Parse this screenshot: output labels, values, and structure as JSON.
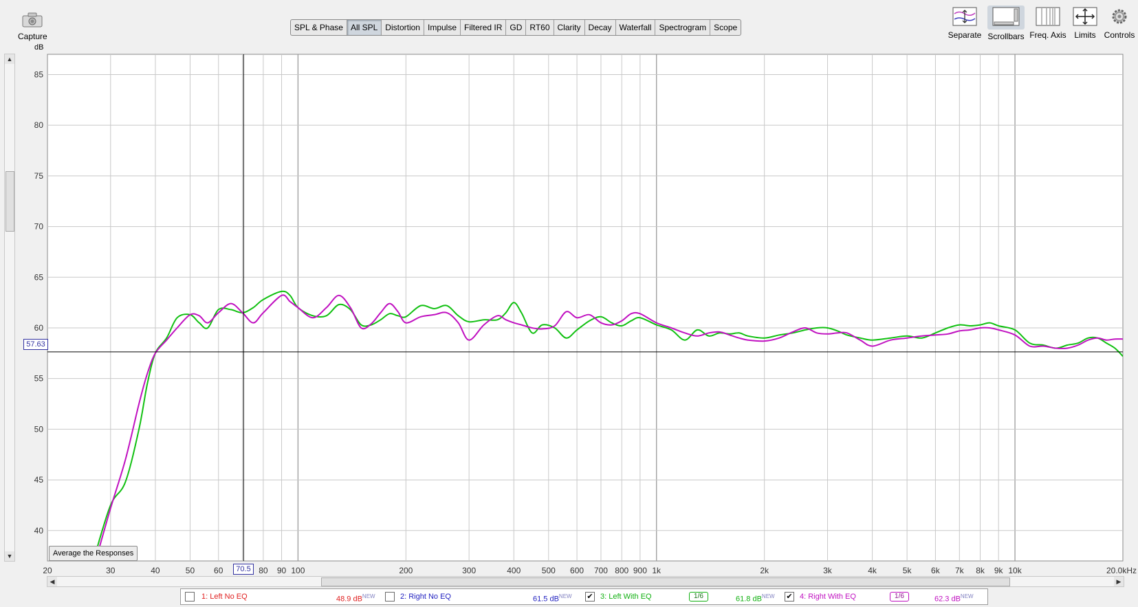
{
  "toolbar": {
    "capture_label": "Capture",
    "tabs": [
      {
        "label": "SPL & Phase",
        "active": false
      },
      {
        "label": "All SPL",
        "active": true
      },
      {
        "label": "Distortion",
        "active": false
      },
      {
        "label": "Impulse",
        "active": false
      },
      {
        "label": "Filtered IR",
        "active": false
      },
      {
        "label": "GD",
        "active": false
      },
      {
        "label": "RT60",
        "active": false
      },
      {
        "label": "Clarity",
        "active": false
      },
      {
        "label": "Decay",
        "active": false
      },
      {
        "label": "Waterfall",
        "active": false
      },
      {
        "label": "Spectrogram",
        "active": false
      },
      {
        "label": "Scope",
        "active": false
      }
    ],
    "right_buttons": {
      "separate": "Separate",
      "scrollbars": "Scrollbars",
      "freq_axis": "Freq. Axis",
      "limits": "Limits",
      "controls": "Controls"
    }
  },
  "graph": {
    "y_unit": "dB",
    "average_button": "Average the Responses",
    "cursor_y_value": "57.63",
    "cursor_x_value": "70.5",
    "background": "#ffffff",
    "grid_color": "#c8c8c8",
    "x_tick_labels": [
      {
        "f": 20,
        "label": "20"
      },
      {
        "f": 30,
        "label": "30"
      },
      {
        "f": 40,
        "label": "40"
      },
      {
        "f": 50,
        "label": "50"
      },
      {
        "f": 60,
        "label": "60"
      },
      {
        "f": 80,
        "label": "80"
      },
      {
        "f": 90,
        "label": "90"
      },
      {
        "f": 100,
        "label": "100"
      },
      {
        "f": 200,
        "label": "200"
      },
      {
        "f": 300,
        "label": "300"
      },
      {
        "f": 400,
        "label": "400"
      },
      {
        "f": 500,
        "label": "500"
      },
      {
        "f": 600,
        "label": "600"
      },
      {
        "f": 700,
        "label": "700"
      },
      {
        "f": 800,
        "label": "800"
      },
      {
        "f": 900,
        "label": "900"
      },
      {
        "f": 1000,
        "label": "1k"
      },
      {
        "f": 2000,
        "label": "2k"
      },
      {
        "f": 3000,
        "label": "3k"
      },
      {
        "f": 4000,
        "label": "4k"
      },
      {
        "f": 5000,
        "label": "5k"
      },
      {
        "f": 6000,
        "label": "6k"
      },
      {
        "f": 7000,
        "label": "7k"
      },
      {
        "f": 8000,
        "label": "8k"
      },
      {
        "f": 9000,
        "label": "9k"
      },
      {
        "f": 10000,
        "label": "10k"
      },
      {
        "f": 20000,
        "label": "20.0kHz"
      }
    ],
    "y_tick_labels": [
      "40",
      "45",
      "50",
      "55",
      "60",
      "65",
      "70",
      "75",
      "80",
      "85"
    ]
  },
  "chart_data": {
    "type": "line",
    "xscale": "log",
    "xlim": [
      20,
      20000
    ],
    "ylim": [
      37,
      87
    ],
    "ylabel": "dB",
    "cursor": {
      "x": 70.5,
      "y": 57.63
    },
    "series": [
      {
        "name": "3: Left With EQ",
        "color": "#10c010",
        "x": [
          27,
          30,
          33,
          36,
          38,
          40,
          43,
          46,
          50,
          53,
          56,
          60,
          65,
          70,
          75,
          80,
          90,
          95,
          100,
          110,
          120,
          130,
          140,
          150,
          160,
          170,
          180,
          190,
          200,
          220,
          240,
          260,
          280,
          300,
          330,
          360,
          380,
          400,
          420,
          450,
          480,
          520,
          560,
          600,
          650,
          700,
          750,
          800,
          850,
          900,
          1000,
          1100,
          1200,
          1300,
          1400,
          1500,
          1600,
          1700,
          1800,
          2000,
          2200,
          2400,
          2600,
          2800,
          3000,
          3200,
          3400,
          3700,
          4000,
          4500,
          5000,
          5500,
          6000,
          6500,
          7000,
          7500,
          8000,
          8500,
          9000,
          10000,
          11000,
          12000,
          13000,
          14000,
          15000,
          16000,
          17000,
          18000,
          19000,
          20000
        ],
        "values": [
          37.3,
          42.5,
          44.8,
          50,
          54.5,
          57.5,
          59,
          61,
          61.3,
          60.5,
          60,
          61.8,
          61.8,
          61.5,
          62,
          62.8,
          63.6,
          63.2,
          62,
          61.2,
          61.2,
          62.3,
          61.8,
          60.3,
          60.3,
          60.8,
          61.4,
          61.2,
          61.1,
          62.2,
          61.9,
          62.2,
          61.2,
          60.6,
          60.8,
          60.8,
          61.5,
          62.5,
          61.5,
          59.5,
          60.3,
          60,
          59,
          59.8,
          60.7,
          61.1,
          60.5,
          60.2,
          60.7,
          61,
          60.3,
          59.8,
          58.8,
          59.8,
          59.2,
          59.5,
          59.4,
          59.5,
          59.2,
          59.0,
          59.3,
          59.5,
          59.8,
          60.0,
          60.0,
          59.7,
          59.3,
          59.0,
          58.8,
          59.0,
          59.2,
          59.0,
          59.5,
          60.0,
          60.3,
          60.2,
          60.3,
          60.5,
          60.2,
          59.8,
          58.5,
          58.3,
          58.0,
          58.3,
          58.5,
          59.0,
          59.0,
          58.5,
          58.0,
          57.2
        ]
      },
      {
        "name": "4: Right With EQ",
        "color": "#c010c0",
        "x": [
          27,
          30,
          33,
          36,
          38,
          40,
          43,
          46,
          50,
          53,
          56,
          60,
          65,
          70,
          75,
          80,
          90,
          95,
          100,
          110,
          120,
          130,
          140,
          150,
          160,
          170,
          180,
          190,
          200,
          220,
          240,
          260,
          280,
          300,
          330,
          360,
          380,
          400,
          420,
          450,
          480,
          520,
          560,
          600,
          650,
          700,
          750,
          800,
          850,
          900,
          1000,
          1100,
          1200,
          1300,
          1400,
          1500,
          1600,
          1700,
          1800,
          2000,
          2200,
          2400,
          2600,
          2800,
          3000,
          3200,
          3400,
          3700,
          4000,
          4500,
          5000,
          5500,
          6000,
          6500,
          7000,
          7500,
          8000,
          8500,
          9000,
          10000,
          11000,
          12000,
          13000,
          14000,
          15000,
          16000,
          17000,
          18000,
          19000,
          20000
        ],
        "values": [
          36.5,
          42.2,
          47,
          52.5,
          55.5,
          57.5,
          58.8,
          60,
          61.3,
          61.2,
          60.5,
          61.5,
          62.4,
          61.5,
          60.5,
          61.5,
          63.2,
          62.6,
          62,
          61,
          62,
          63.2,
          62,
          60,
          60.4,
          61.5,
          62.4,
          61.6,
          60.5,
          61.1,
          61.3,
          61.5,
          60.5,
          58.8,
          60.3,
          61.2,
          60.8,
          60.5,
          60.3,
          60,
          59.9,
          60.2,
          61.6,
          61,
          61.3,
          60.5,
          60.3,
          60.7,
          61.4,
          61.4,
          60.5,
          60.0,
          59.5,
          59.2,
          59.5,
          59.6,
          59.3,
          59.0,
          58.8,
          58.7,
          59.0,
          59.6,
          60.0,
          59.5,
          59.4,
          59.5,
          59.5,
          58.8,
          58.2,
          58.8,
          59.0,
          59.2,
          59.3,
          59.4,
          59.7,
          59.8,
          60.0,
          60.0,
          59.8,
          59.3,
          58.2,
          58.2,
          58.0,
          58.0,
          58.3,
          58.8,
          59.0,
          58.8,
          58.9,
          58.9
        ]
      }
    ]
  },
  "legend": {
    "items": [
      {
        "label": "1: Left No EQ",
        "value": "48.9 dB",
        "badge": "NEW",
        "color": "#e02020",
        "checked": false
      },
      {
        "label": "2: Right No EQ",
        "value": "61.5 dB",
        "badge": "NEW",
        "color": "#2020c0",
        "checked": false
      },
      {
        "label": "3: Left With EQ",
        "value": "61.8 dB",
        "badge": "NEW",
        "color": "#10b010",
        "checked": true,
        "smoothing": "1/6"
      },
      {
        "label": "4: Right With EQ",
        "value": "62.3 dB",
        "badge": "NEW",
        "color": "#c010c0",
        "checked": true,
        "smoothing": "1/6"
      }
    ]
  }
}
